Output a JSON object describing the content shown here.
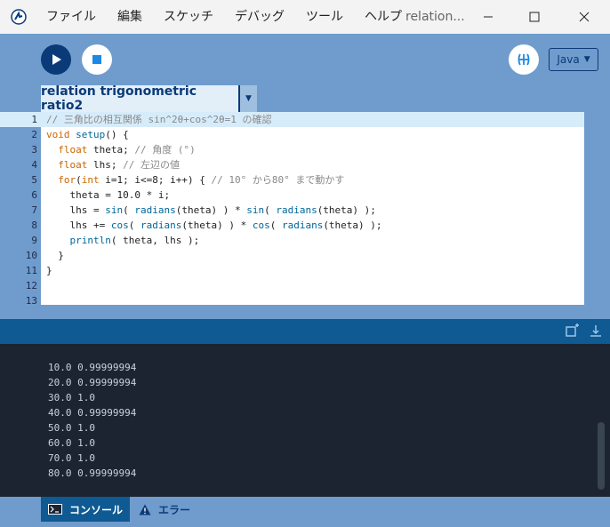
{
  "window": {
    "title": "relation...",
    "menu": [
      "ファイル",
      "編集",
      "スケッチ",
      "デバッグ",
      "ツール",
      "ヘルプ"
    ]
  },
  "toolbar": {
    "mode": "Java"
  },
  "tab": {
    "name": "relation trigonometric ratio2"
  },
  "editor": {
    "line_numbers": [
      "1",
      "2",
      "3",
      "4",
      "5",
      "6",
      "7",
      "8",
      "9",
      "10",
      "11",
      "12",
      "13"
    ],
    "lines": [
      "// 三角比の相互関係 sin^2θ+cos^2θ=1 の確認",
      "void setup() {",
      "  float theta; // 角度 (°)",
      "  float lhs; // 左辺の値",
      "  for(int i=1; i<=8; i++) { // 10° から80° まで動かす",
      "    theta = 10.0 * i;",
      "    lhs = sin( radians(theta) ) * sin( radians(theta) );",
      "    lhs += cos( radians(theta) ) * cos( radians(theta) );",
      "    println( theta, lhs );",
      "  }",
      "}",
      "",
      ""
    ]
  },
  "console": {
    "lines": [
      "10.0 0.99999994",
      "20.0 0.99999994",
      "30.0 1.0",
      "40.0 0.99999994",
      "50.0 1.0",
      "60.0 1.0",
      "70.0 1.0",
      "80.0 0.99999994"
    ]
  },
  "footer": {
    "console_label": "コンソール",
    "errors_label": "エラー"
  },
  "colors": {
    "toolbar_bg": "#6f9ccd",
    "accent_dark": "#0b3a78",
    "console_bar": "#0f5a92",
    "console_bg": "#1b2430",
    "current_line": "#d7ecfa"
  }
}
